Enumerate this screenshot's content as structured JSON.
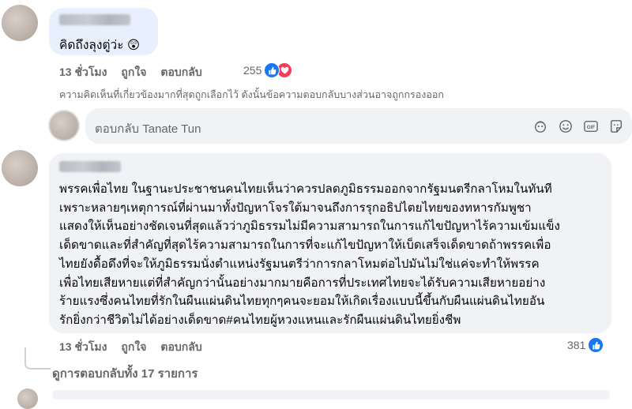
{
  "comment1": {
    "text": "คิดถึงลุงตู่ว่ะ 😲",
    "time": "13 ชั่วโมง",
    "like_label": "ถูกใจ",
    "reply_label": "ตอบกลับ",
    "reaction_count": "255"
  },
  "notice": "ความคิดเห็นที่เกี่ยวข้องมากที่สุดถูกเลือกไว้ ดังนั้นข้อความตอบกลับบางส่วนอาจถูกกรองออก",
  "reply_box": {
    "placeholder": "ตอบกลับ Tanate Tun",
    "icons": [
      "sticker-icon",
      "emoji-icon",
      "gif-icon",
      "avatar-sticker-icon"
    ]
  },
  "comment2": {
    "text": "พรรคเพื่อไทย ในฐานะประชาชนคนไทยเห็นว่าควรปลดภูมิธรรมออกจากรัฐมนตรีกลาโหมในทันที\nเพราะหลายๆเหตุการณ์ที่ผ่านมาทั้งปัญหาโจรใต้มาจนถึงการรุกอธิปไตยไทยของทหารกัมพูชา\nแสดงให้เห็นอย่างชัดเจนที่สุดแล้วว่าภูมิธรรมไม่มีความสามารถในการแก้ไขปัญหาไร้ความเข้มแข็ง\nเด็ดขาดและที่สำคัญที่สุดไร้ความสามารถในการที่จะแก้ไขปัญหาให้เบ็ดเสร็จเด็ดขาดถ้าพรรคเพื่อ\nไทยยังดื้อดึงที่จะให้ภูมิธรรมนั่งตำแหน่งรัฐมนตรีว่าการกลาโหมต่อไปมันไม่ใช่แค่จะทำให้พรรค\nเพื่อไทยเสียหายแต่ที่สำคัญกว่านั้นอย่างมากมายคือการที่ประเทศไทยจะได้รับความเสียหายอย่าง\nร้ายแรงซึ่งคนไทยที่รักในผืนแผ่นดินไทยทุกๆคนจะยอมให้เกิดเรื่องแบบนี้ขึ้นกับผืนแผ่นดินไทยอัน\nรักยิ่งกว่าชีวิตไม่ได้อย่างเด็ดขาด#คนไทยผู้หวงแหนและรักผืนแผ่นดินไทยยิ่งชีพ",
    "time": "13 ชั่วโมง",
    "like_label": "ถูกใจ",
    "reply_label": "ตอบกลับ",
    "reaction_count": "381"
  },
  "view_replies": "ดูการตอบกลับทั้ง 17 รายการ",
  "colors": {
    "like_blue": "#1877f2",
    "love_red": "#f33e58",
    "bubble_bg": "#f0f2f5",
    "meta_gray": "#65676b"
  }
}
